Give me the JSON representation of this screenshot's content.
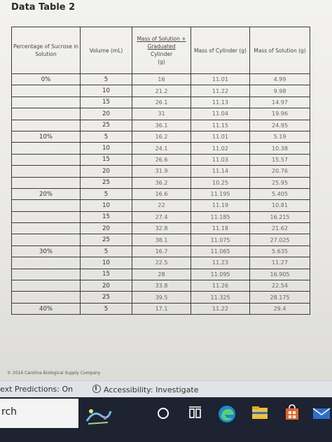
{
  "document": {
    "title": "Data Table 2",
    "headers": {
      "percentage": "Percentage of Sucrose in Solution",
      "volume": "Volume (mL)",
      "mass_solution_cylinder_a": "Mass of Solution +",
      "mass_solution_cylinder_b": "Graduated",
      "mass_solution_cylinder_c": "Cylinder",
      "mass_solution_cylinder_d": "(g)",
      "mass_cylinder": "Mass of Cylinder (g)",
      "mass_solution": "Mass of Solution (g)"
    },
    "rows": [
      {
        "pct": "0%",
        "vol": "5",
        "msg": "16",
        "mc": "11.01",
        "ms": "4.99"
      },
      {
        "pct": "",
        "vol": "10",
        "msg": "21.2",
        "mc": "11.22",
        "ms": "9.98"
      },
      {
        "pct": "",
        "vol": "15",
        "msg": "26.1",
        "mc": "11.13",
        "ms": "14.97"
      },
      {
        "pct": "",
        "vol": "20",
        "msg": "31",
        "mc": "11.04",
        "ms": "19.96"
      },
      {
        "pct": "",
        "vol": "25",
        "msg": "36.1",
        "mc": "11.15",
        "ms": "24.95"
      },
      {
        "pct": "10%",
        "vol": "5",
        "msg": "16.2",
        "mc": "11.01",
        "ms": "5.19"
      },
      {
        "pct": "",
        "vol": "10",
        "msg": "24.1",
        "mc": "11.02",
        "ms": "10.38"
      },
      {
        "pct": "",
        "vol": "15",
        "msg": "26.6",
        "mc": "11.03",
        "ms": "15.57"
      },
      {
        "pct": "",
        "vol": "20",
        "msg": "31.9",
        "mc": "11.14",
        "ms": "20.76"
      },
      {
        "pct": "",
        "vol": "25",
        "msg": "36.2",
        "mc": "10.25",
        "ms": "25.95"
      },
      {
        "pct": "20%",
        "vol": "5",
        "msg": "16.6",
        "mc": "11.195",
        "ms": "5.405"
      },
      {
        "pct": "",
        "vol": "10",
        "msg": "22",
        "mc": "11.19",
        "ms": "10.81"
      },
      {
        "pct": "",
        "vol": "15",
        "msg": "27.4",
        "mc": "11.185",
        "ms": "16.215"
      },
      {
        "pct": "",
        "vol": "20",
        "msg": "32.8",
        "mc": "11.18",
        "ms": "21.62"
      },
      {
        "pct": "",
        "vol": "25",
        "msg": "38.1",
        "mc": "11.075",
        "ms": "27.025"
      },
      {
        "pct": "30%",
        "vol": "5",
        "msg": "16.7",
        "mc": "11.065",
        "ms": "5.635"
      },
      {
        "pct": "",
        "vol": "10",
        "msg": "22.5",
        "mc": "11.23",
        "ms": "11.27"
      },
      {
        "pct": "",
        "vol": "15",
        "msg": "28",
        "mc": "11.095",
        "ms": "16.905"
      },
      {
        "pct": "",
        "vol": "20",
        "msg": "33.8",
        "mc": "11.26",
        "ms": "22.54"
      },
      {
        "pct": "",
        "vol": "25",
        "msg": "39.5",
        "mc": "11.325",
        "ms": "28.175"
      },
      {
        "pct": "40%",
        "vol": "5",
        "msg": "17.1",
        "mc": "11.22",
        "ms": "29.4"
      }
    ],
    "copyright": "© 2016 Carolina Biological Supply Company"
  },
  "statusbar": {
    "text_predictions": "ext Predictions: On",
    "accessibility": "Accessibility: Investigate"
  },
  "taskbar": {
    "search_text": "rch",
    "icons": [
      "sketch-app-icon",
      "cortana-icon",
      "task-view-icon",
      "edge-icon",
      "file-explorer-icon",
      "store-icon",
      "mail-icon"
    ]
  },
  "colors": {
    "taskbar_bg": "#1d2330",
    "edge_blue": "#1a8ad4",
    "explorer_yellow": "#f1c232",
    "store_orange": "#e5672b",
    "mail_blue": "#2b6fce"
  }
}
